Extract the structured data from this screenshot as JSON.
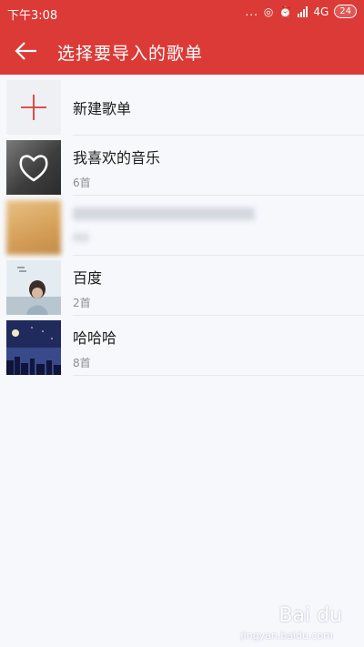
{
  "status_bar": {
    "time": "下午3:08",
    "dots": "...",
    "network": "4G",
    "battery": "24"
  },
  "app_bar": {
    "title": "选择要导入的歌单"
  },
  "playlists": [
    {
      "title": "新建歌单",
      "count": ""
    },
    {
      "title": "我喜欢的音乐",
      "count": "6首"
    },
    {
      "title": "",
      "count": ""
    },
    {
      "title": "百度",
      "count": "2首"
    },
    {
      "title": "哈哈哈",
      "count": "8首"
    }
  ],
  "watermark": {
    "logo": "Bai du",
    "sub": "jingyan.baidu.com"
  },
  "colors": {
    "accent": "#dc3a36",
    "background": "#f6f8fc"
  }
}
